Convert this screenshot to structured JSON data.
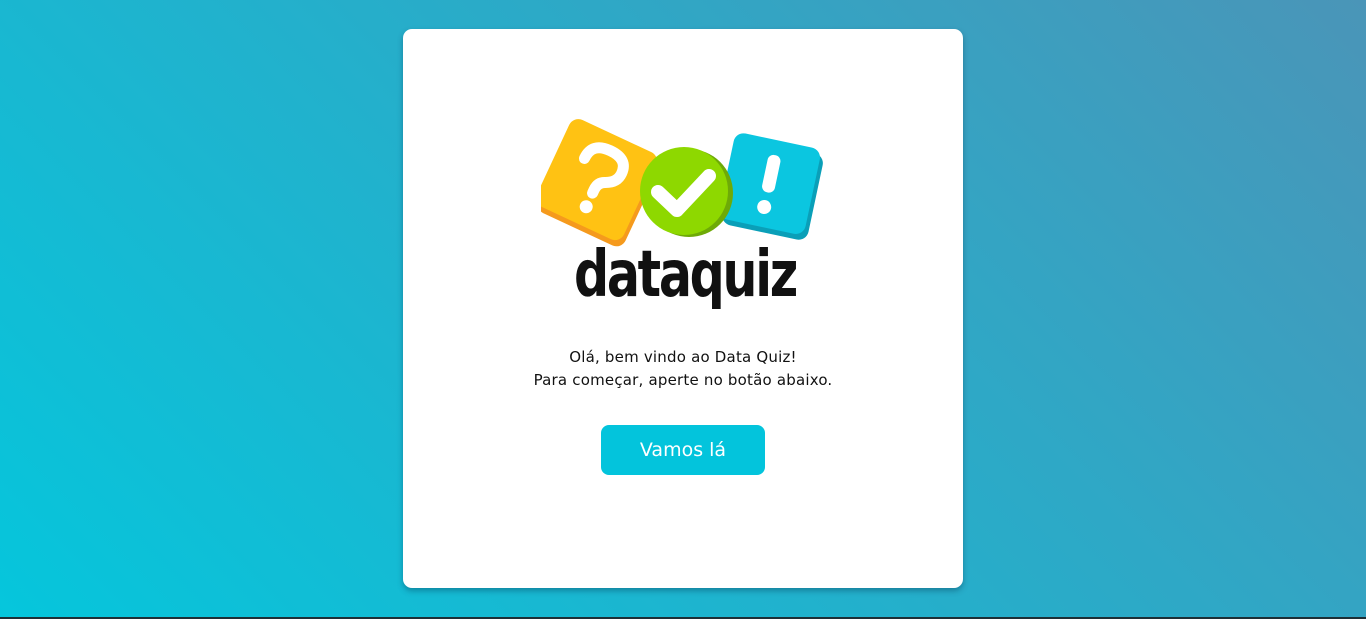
{
  "brand": {
    "logo_text": "dataquiz",
    "colors": {
      "question_tile": "#ffc213",
      "check_circle": "#8ed800",
      "exclaim_tile": "#0bc6e0",
      "wordmark": "#111111"
    },
    "icons": [
      "question-mark-icon",
      "check-mark-icon",
      "exclamation-mark-icon"
    ]
  },
  "welcome": {
    "line1": "Olá, bem vindo ao Data Quiz!",
    "line2": "Para começar, aperte no botão abaixo."
  },
  "actions": {
    "start_label": "Vamos lá",
    "accent": "#03c4dc"
  }
}
